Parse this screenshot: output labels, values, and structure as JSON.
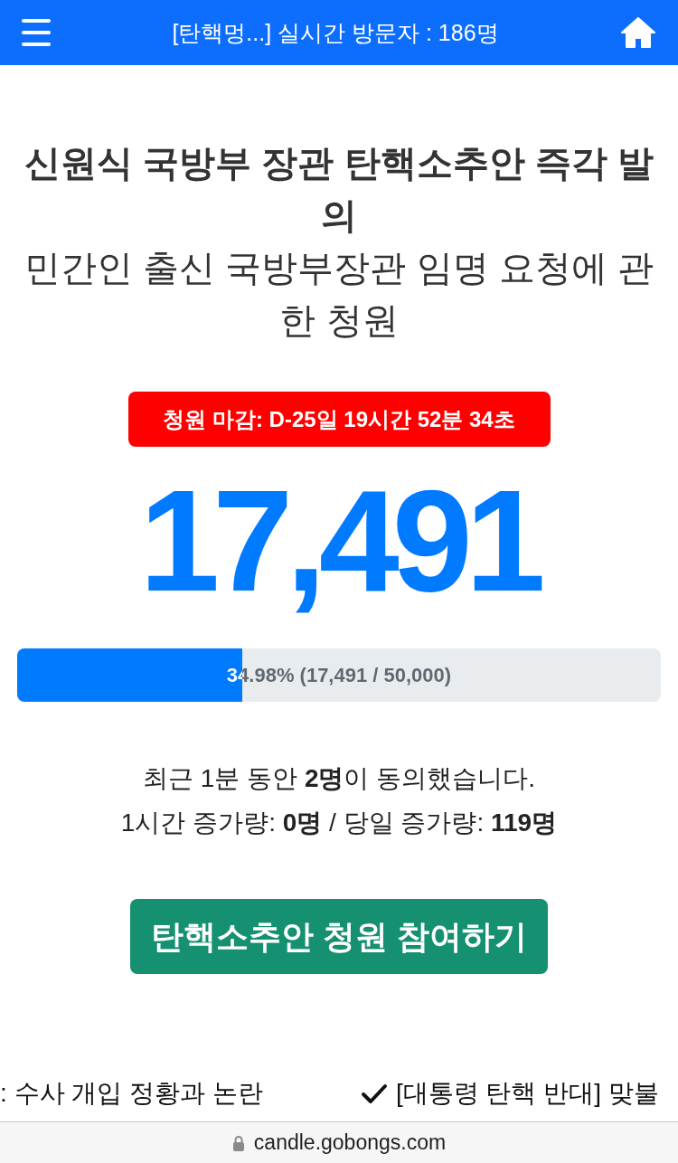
{
  "header": {
    "title": "[탄핵멍...] 실시간 방문자 : 186명"
  },
  "petition": {
    "title": "신원식 국방부 장관 탄핵소추안 즉각 발의",
    "subtitle": "민간인 출신 국방부장관 임명 요청에 관한 청원"
  },
  "deadline": "청원 마감: D-25일 19시간 52분 34초",
  "count": "17,491",
  "progress": {
    "level": 0.3498,
    "label": "34.98% (17,491 / 50,000)"
  },
  "stats": [
    "최근 1분 동안 **2명**이 동의했습니다.",
    "1시간 증가량: **0명** / 당일 증가량: **119명**"
  ],
  "join_button": "탄핵소추안 청원 참여하기",
  "ticker": [
    {
      "kind": "plain",
      "text": ": 수사 개입 정황과 논란"
    },
    {
      "kind": "checkmarked",
      "text": "[대통령 탄핵 반대] 맞불"
    }
  ],
  "address_bar": {
    "url": "candle.gobongs.com"
  }
}
